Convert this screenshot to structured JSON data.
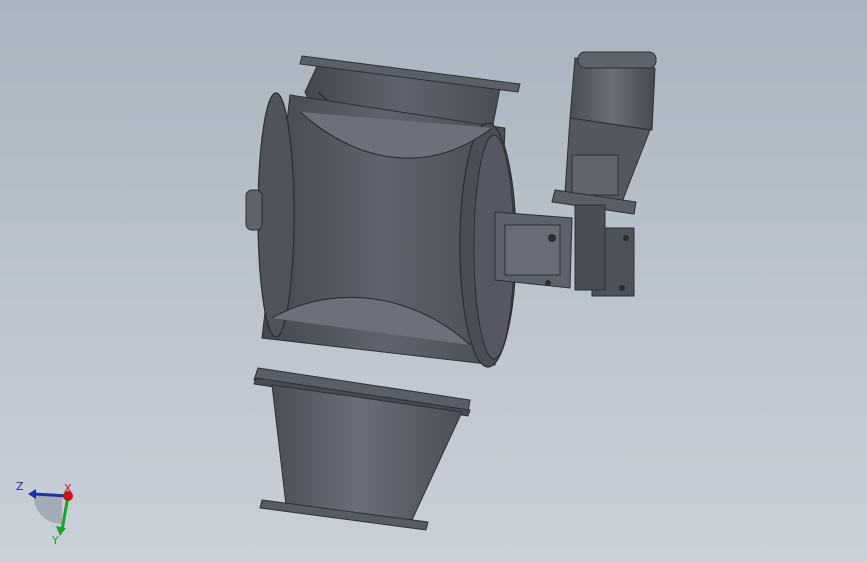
{
  "triad": {
    "z_label": "Z",
    "y_label": "Y",
    "x_label": "X",
    "z_color": "#1a2fa8",
    "y_color": "#19a32c",
    "x_color": "#c01818"
  },
  "colors": {
    "background_top": "#a9b4c0",
    "background_bottom": "#c9d0d8",
    "body_dark": "#3d4048",
    "body_mid": "#5a5e68",
    "body_light": "#6e727c"
  }
}
